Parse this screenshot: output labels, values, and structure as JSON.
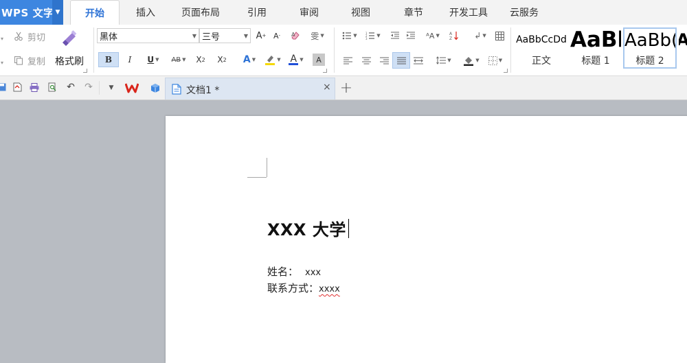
{
  "app": {
    "name": "WPS 文字"
  },
  "menu": {
    "tabs": [
      "开始",
      "插入",
      "页面布局",
      "引用",
      "审阅",
      "视图",
      "章节",
      "开发工具",
      "云服务"
    ],
    "active_index": 0
  },
  "clipboard": {
    "cut": "剪切",
    "copy": "复制",
    "format_painter": "格式刷"
  },
  "font": {
    "name": "黑体",
    "size": "三号"
  },
  "styles": [
    {
      "sample": "AaBbCcDd",
      "name": "正文"
    },
    {
      "sample": "AaBb",
      "name": "标题 1"
    },
    {
      "sample": "AaBb(",
      "name": "标题 2"
    },
    {
      "sample": "A",
      "name": ""
    }
  ],
  "doc_tab": {
    "title": "文档1 *"
  },
  "document": {
    "title": "XXX 大学",
    "lines": [
      {
        "label": "姓名：",
        "value": "xxx"
      },
      {
        "label": "联系方式：",
        "value": "xxxx"
      }
    ]
  },
  "colors": {
    "accent": "#2e73d6",
    "app_button": "#3d86e0",
    "font_red": "#e02020",
    "highlight_yellow": "#f5d800",
    "font_color_blue": "#1f4fd8",
    "wps_logo": "#d9261c"
  }
}
